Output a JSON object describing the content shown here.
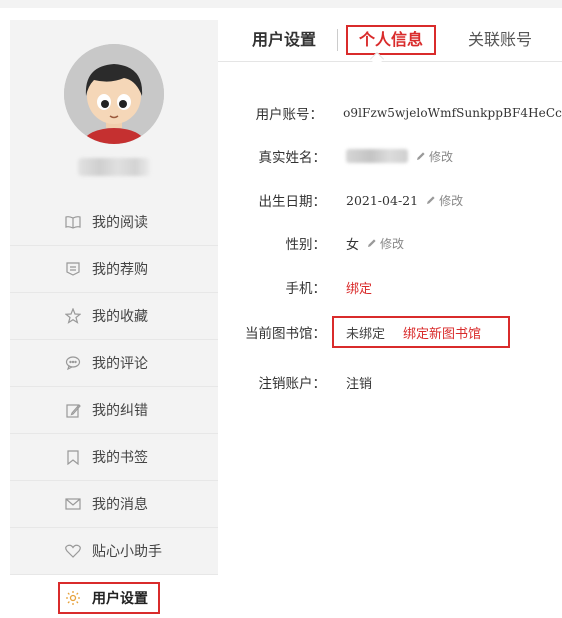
{
  "tabs": {
    "user_settings": "用户设置",
    "personal_info": "个人信息",
    "linked_accounts": "关联账号"
  },
  "sidebar": {
    "items": [
      {
        "label": "我的阅读",
        "icon": "book-icon"
      },
      {
        "label": "我的荐购",
        "icon": "recommend-icon"
      },
      {
        "label": "我的收藏",
        "icon": "star-icon"
      },
      {
        "label": "我的评论",
        "icon": "comment-icon"
      },
      {
        "label": "我的纠错",
        "icon": "edit-icon"
      },
      {
        "label": "我的书签",
        "icon": "bookmark-icon"
      },
      {
        "label": "我的消息",
        "icon": "mail-icon"
      },
      {
        "label": "贴心小助手",
        "icon": "heart-icon"
      },
      {
        "label": "用户设置",
        "icon": "gear-icon",
        "active": true
      }
    ]
  },
  "info": {
    "account": {
      "label": "用户账号：",
      "value": "o9lFzw5wjeloWmfSunkppBF4HeCc"
    },
    "realname": {
      "label": "真实姓名：",
      "edit": "修改"
    },
    "birthdate": {
      "label": "出生日期：",
      "value": "2021-04-21",
      "edit": "修改"
    },
    "gender": {
      "label": "性别：",
      "value": "女",
      "edit": "修改"
    },
    "phone": {
      "label": "手机：",
      "value": "绑定"
    },
    "library": {
      "label": "当前图书馆：",
      "value": "未绑定",
      "action": "绑定新图书馆"
    },
    "cancel": {
      "label": "注销账户：",
      "value": "注销"
    }
  },
  "colors": {
    "accent": "#d92b2b",
    "active_icon": "#e6a23c",
    "sidebar_bg": "#f3f3f3"
  }
}
